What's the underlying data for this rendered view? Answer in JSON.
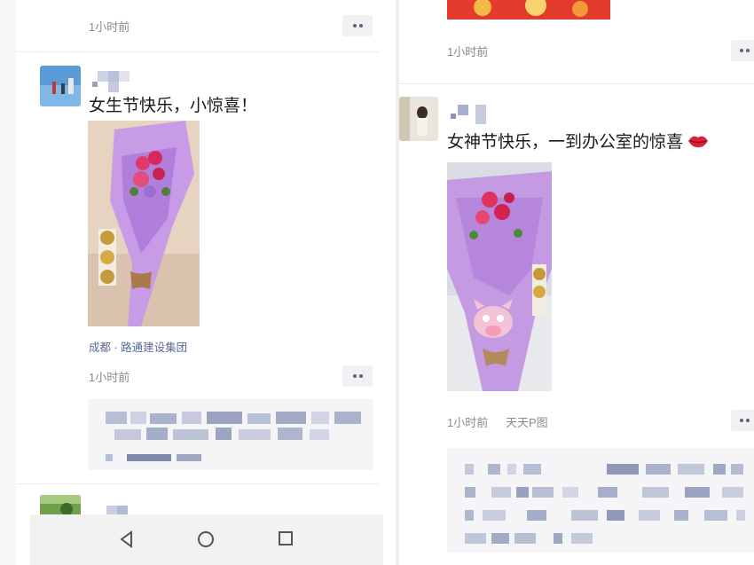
{
  "left_feed": {
    "top_post": {
      "time": "1小时前"
    },
    "post": {
      "text": "女生节快乐，小惊喜！",
      "location": "成都 · 路通建设集团",
      "time": "1小时前"
    }
  },
  "right_feed": {
    "top_post": {
      "time": "1小时前"
    },
    "post": {
      "text": "女神节快乐，一到办公室的惊喜",
      "time": "1小时前",
      "app_source": "天天P图"
    }
  },
  "icons": {
    "more": "more-dots-icon",
    "back": "nav-back-icon",
    "home": "nav-home-icon",
    "recents": "nav-recents-icon",
    "lips": "lips-emoji-icon"
  },
  "colors": {
    "link": "#576b95",
    "time": "#8a8a8a",
    "wrap_purple": "#b98be0"
  }
}
